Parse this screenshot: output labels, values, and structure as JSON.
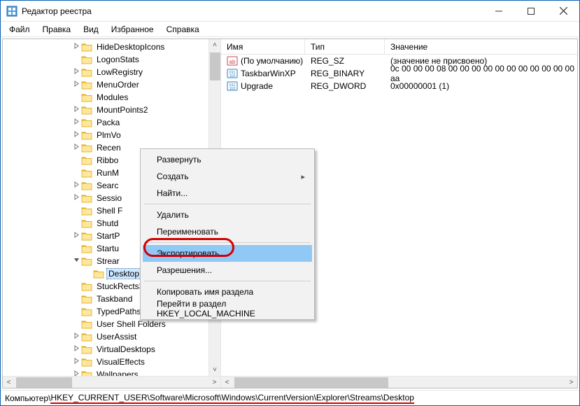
{
  "title": "Редактор реестра",
  "menubar": [
    "Файл",
    "Правка",
    "Вид",
    "Избранное",
    "Справка"
  ],
  "tree_items": [
    {
      "label": "HideDesktopIcons",
      "indent": 1,
      "exp": ">"
    },
    {
      "label": "LogonStats",
      "indent": 1,
      "exp": ""
    },
    {
      "label": "LowRegistry",
      "indent": 1,
      "exp": ">"
    },
    {
      "label": "MenuOrder",
      "indent": 1,
      "exp": ">"
    },
    {
      "label": "Modules",
      "indent": 1,
      "exp": ""
    },
    {
      "label": "MountPoints2",
      "indent": 1,
      "exp": ">"
    },
    {
      "label": "Packa",
      "indent": 1,
      "exp": ">"
    },
    {
      "label": "PlmVo",
      "indent": 1,
      "exp": ">"
    },
    {
      "label": "Recen",
      "indent": 1,
      "exp": ">"
    },
    {
      "label": "Ribbo",
      "indent": 1,
      "exp": ""
    },
    {
      "label": "RunM",
      "indent": 1,
      "exp": ""
    },
    {
      "label": "Searc",
      "indent": 1,
      "exp": ">"
    },
    {
      "label": "Sessio",
      "indent": 1,
      "exp": ">"
    },
    {
      "label": "Shell F",
      "indent": 1,
      "exp": ""
    },
    {
      "label": "Shutd",
      "indent": 1,
      "exp": ""
    },
    {
      "label": "StartP",
      "indent": 1,
      "exp": ">"
    },
    {
      "label": "Startu",
      "indent": 1,
      "exp": ""
    },
    {
      "label": "Strear",
      "indent": 1,
      "exp": "v"
    },
    {
      "label": "Desktop",
      "indent": 2,
      "exp": "",
      "selected": true
    },
    {
      "label": "StuckRects3",
      "indent": 1,
      "exp": ""
    },
    {
      "label": "Taskband",
      "indent": 1,
      "exp": ""
    },
    {
      "label": "TypedPaths",
      "indent": 1,
      "exp": ""
    },
    {
      "label": "User Shell Folders",
      "indent": 1,
      "exp": ""
    },
    {
      "label": "UserAssist",
      "indent": 1,
      "exp": ">"
    },
    {
      "label": "VirtualDesktops",
      "indent": 1,
      "exp": ">"
    },
    {
      "label": "VisualEffects",
      "indent": 1,
      "exp": ">"
    },
    {
      "label": "Wallpapers",
      "indent": 1,
      "exp": ">"
    }
  ],
  "list_columns": {
    "name": "Имя",
    "type": "Тип",
    "value": "Значение"
  },
  "list_rows": [
    {
      "icon": "str",
      "name": "(По умолчанию)",
      "type": "REG_SZ",
      "value": "(значение не присвоено)"
    },
    {
      "icon": "bin",
      "name": "TaskbarWinXP",
      "type": "REG_BINARY",
      "value": "0c 00 00 00 08 00 00 00 00 00 00 00 00 00 00 00 aa"
    },
    {
      "icon": "bin",
      "name": "Upgrade",
      "type": "REG_DWORD",
      "value": "0x00000001 (1)"
    }
  ],
  "context_menu": [
    {
      "label": "Развернуть"
    },
    {
      "label": "Создать",
      "sub": true
    },
    {
      "label": "Найти..."
    },
    {
      "sep": true
    },
    {
      "label": "Удалить"
    },
    {
      "label": "Переименовать"
    },
    {
      "sep": true
    },
    {
      "label": "Экспортировать",
      "highlight": true
    },
    {
      "label": "Разрешения..."
    },
    {
      "sep": true
    },
    {
      "label": "Копировать имя раздела"
    },
    {
      "label": "Перейти в раздел HKEY_LOCAL_MACHINE"
    }
  ],
  "status_prefix": "Компьютер\\",
  "status_path": "HKEY_CURRENT_USER\\Software\\Microsoft\\Windows\\CurrentVersion\\Explorer\\Streams\\Desktop"
}
